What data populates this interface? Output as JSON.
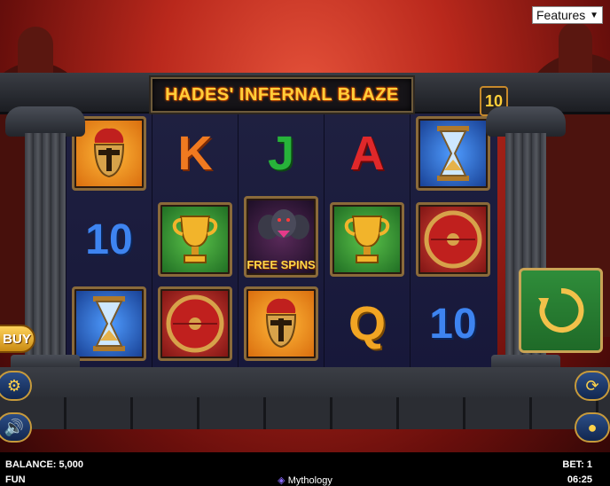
{
  "toolbar": {
    "features_label": "Features"
  },
  "game": {
    "title": "HADES' INFERNAL BLAZE",
    "paylines": "10"
  },
  "reels": {
    "r1": {
      "c1": "helmet",
      "c2": "10",
      "c3": "hourglass"
    },
    "r2": {
      "c1": "K",
      "c2": "trophy",
      "c3": "shield"
    },
    "r3": {
      "c1": "J",
      "c2": "cerberus",
      "c2_label": "FREE SPINS",
      "c3": "helmet"
    },
    "r4": {
      "c1": "A",
      "c2": "trophy",
      "c3": "Q"
    },
    "r5": {
      "c1": "hourglass",
      "c2": "shield",
      "c3": "10"
    }
  },
  "controls": {
    "buy_label": "BUY"
  },
  "status": {
    "balance": "BALANCE: 5,000",
    "mode": "FUN",
    "category": "Mythology",
    "bet": "BET: 1",
    "clock": "06:25"
  },
  "colors": {
    "accent_gold": "#ffcf3a",
    "spin_green": "#2f8d3a",
    "reel_bg": "#1d1d38"
  }
}
